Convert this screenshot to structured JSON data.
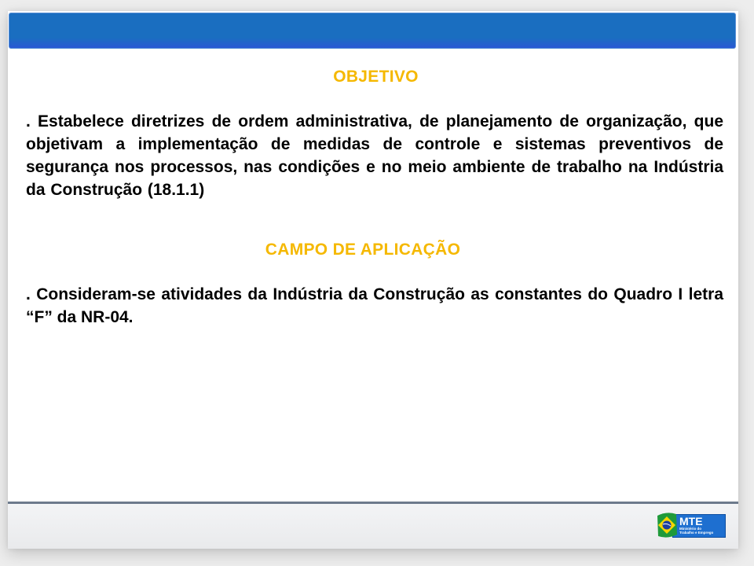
{
  "slide": {
    "section1": {
      "heading": "OBJETIVO",
      "paragraph": ".  Estabelece diretrizes de ordem administrativa, de planejamento de organização, que objetivam a implementação de medidas de controle e sistemas preventivos de segurança nos processos, nas condições e no meio ambiente de trabalho na Indústria da Construção (18.1.1)"
    },
    "section2": {
      "heading": "CAMPO  DE  APLICAÇÃO",
      "paragraph": ". Consideram-se atividades da Indústria da Construção as constantes do Quadro I  letra “F”  da NR-04."
    },
    "footer": {
      "logo": {
        "title": "MTE",
        "subtitle_line1": "Ministério do",
        "subtitle_line2": "Trabalho e Emprego",
        "icon": "brazil-flag-icon"
      }
    }
  },
  "colors": {
    "header_blue": "#1a6ec0",
    "heading_yellow": "#f5b800",
    "footer_line": "#6c7a8c"
  }
}
